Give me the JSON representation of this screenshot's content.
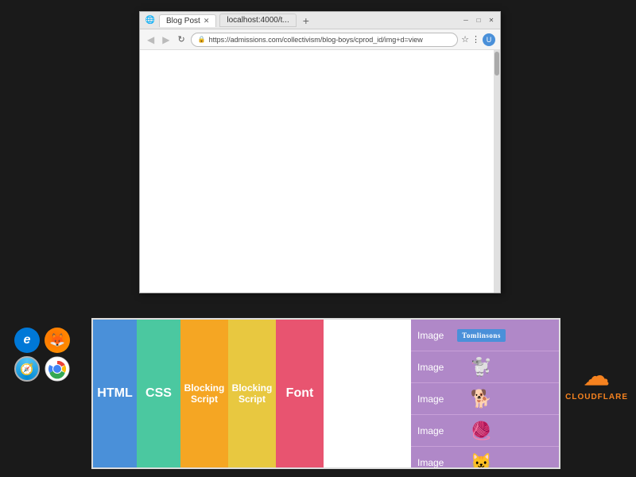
{
  "browser": {
    "tab_label": "Blog Post",
    "tab_label2": "localhost:4000/t...",
    "url": "https://admissions.com/collectivism/blog-boys/cprod_id/img+d=view",
    "favicon": "🌐",
    "window_minimize": "─",
    "window_restore": "□",
    "window_close": "✕"
  },
  "resource_columns": [
    {
      "id": "html",
      "label": "HTML",
      "color": "#4a90d9"
    },
    {
      "id": "css",
      "label": "CSS",
      "color": "#4bc8a0"
    },
    {
      "id": "blocking1",
      "label": "Blocking\nScript",
      "color": "#f5a623"
    },
    {
      "id": "blocking2",
      "label": "Blocking\nScript",
      "color": "#e8c840"
    },
    {
      "id": "font",
      "label": "Font",
      "color": "#e85470"
    }
  ],
  "image_rows": [
    {
      "label": "Image",
      "emoji": "🏷️",
      "type": "logo",
      "logo_text": "Tomlinsons"
    },
    {
      "label": "Image",
      "emoji": "🐩",
      "type": "emoji"
    },
    {
      "label": "Image",
      "emoji": "🐕",
      "type": "emoji"
    },
    {
      "label": "Image",
      "emoji": "🧶",
      "type": "emoji"
    },
    {
      "label": "Image",
      "emoji": "🐱",
      "type": "emoji"
    }
  ],
  "browser_icons": {
    "ie_label": "e",
    "firefox_label": "🦊",
    "safari_label": "⊙",
    "chrome_label": "🌐"
  },
  "cloudflare": {
    "cloud": "☁",
    "text": "CLOUDFLARE"
  }
}
